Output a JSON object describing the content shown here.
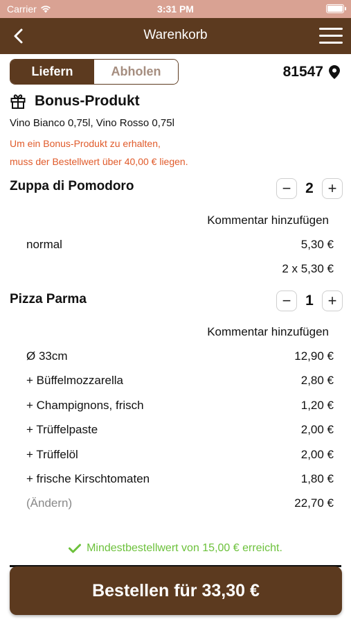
{
  "status_bar": {
    "carrier": "Carrier",
    "time": "3:31 PM"
  },
  "navbar": {
    "title": "Warenkorb"
  },
  "delivery_toggle": {
    "options": [
      "Liefern",
      "Abholen"
    ],
    "selected": "Liefern"
  },
  "postal_code": "81547",
  "bonus": {
    "title": "Bonus-Produkt",
    "products": "Vino Bianco 0,75l, Vino Rosso 0,75l",
    "note_line1": "Um ein Bonus-Produkt zu erhalten,",
    "note_line2": "muss der Bestellwert über 40,00 € liegen."
  },
  "items": [
    {
      "name": "Zuppa di Pomodoro",
      "quantity": "2",
      "comment_label": "Kommentar hinzufügen",
      "lines": [
        {
          "label": "normal",
          "price": "5,30 €"
        }
      ],
      "total_line": "2 x 5,30 €"
    },
    {
      "name": "Pizza Parma",
      "quantity": "1",
      "comment_label": "Kommentar hinzufügen",
      "lines": [
        {
          "label": "Ø 33cm",
          "price": "12,90 €"
        },
        {
          "label": "+ Büffelmozzarella",
          "price": "2,80 €"
        },
        {
          "label": "+ Champignons, frisch",
          "price": "1,20 €"
        },
        {
          "label": "+ Trüffelpaste",
          "price": "2,00 €"
        },
        {
          "label": "+ Trüffelöl",
          "price": "2,00 €"
        },
        {
          "label": "+ frische Kirschtomaten",
          "price": "1,80 €"
        },
        {
          "label": "(Ändern)",
          "price": "22,70 €"
        }
      ]
    }
  ],
  "min_order_msg": "Mindestbestellwert von 15,00 € erreicht.",
  "order_button": "Bestellen für 33,30 €",
  "colors": {
    "brand": "#5c3a1f",
    "warning": "#e05a2a",
    "success": "#6cc13b",
    "statusbar": "#d9a293"
  }
}
